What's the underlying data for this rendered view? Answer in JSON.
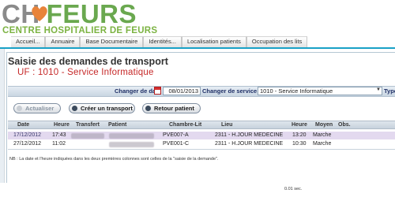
{
  "header": {
    "logo": {
      "ch": "CH",
      "name": "FEURS",
      "subtitle": "CENTRE HOSPITALIER DE FEURS"
    }
  },
  "nav": {
    "items": [
      {
        "label": "Accueil..."
      },
      {
        "label": "Annuaire"
      },
      {
        "label": "Base Documentaire"
      },
      {
        "label": "Identités..."
      },
      {
        "label": "Localisation patients"
      },
      {
        "label": "Occupation des lits"
      }
    ]
  },
  "page": {
    "title": "Saisie des demandes de transport",
    "uf": "UF : 1010 - Service Informatique"
  },
  "filters": {
    "date_label": "Changer de date",
    "date_value": "08/01/2013",
    "service_label": "Changer de service",
    "service_value": "1010 - Service Informatique",
    "type_label": "Type"
  },
  "actions": {
    "refresh": "Actualiser",
    "create": "Créer un transport",
    "return": "Retour patient"
  },
  "table": {
    "headers": {
      "date": "Date",
      "heure": "Heure",
      "transfert": "Transfert",
      "patient": "Patient",
      "chambre": "Chambre-Lit",
      "lieu": "Lieu",
      "heure2": "Heure",
      "moyen": "Moyen",
      "obs": "Obs."
    },
    "rows": [
      {
        "date": "17/12/2012",
        "heure": "17:43",
        "chambre": "PVE007-A",
        "lieu": "2311 - H.JOUR MEDECINE",
        "heure2": "13:20",
        "moyen": "Marche"
      },
      {
        "date": "27/12/2012",
        "heure": "11:02",
        "chambre": "PVE001-C",
        "lieu": "2311 - H.JOUR MEDECINE",
        "heure2": "10:30",
        "moyen": "Marche"
      }
    ]
  },
  "footer": {
    "note": "NB : La date et l'heure indiquées dans les deux premières colonnes sont celles de la \"saisie de la demande\".",
    "timing": "0.01 sec."
  },
  "colors": {
    "nav_accent": "#19a1c6",
    "uf_red": "#c62828",
    "logo_green": "#6aa84f",
    "row_highlight": "#e3d9ef"
  }
}
